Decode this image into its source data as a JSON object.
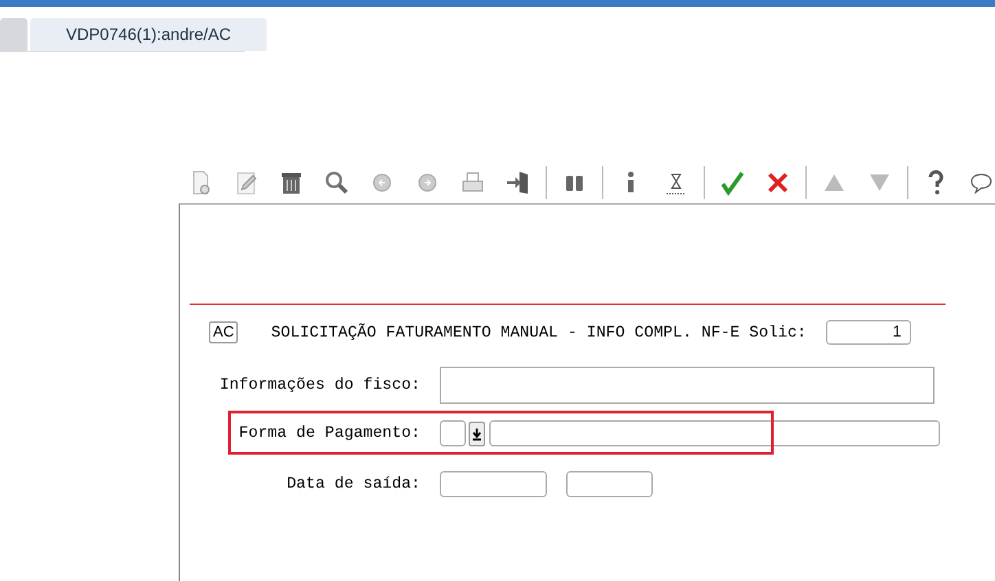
{
  "tabs": [
    {
      "selected": false
    },
    {
      "label": "VDP0746(1):andre/AC",
      "selected": true
    }
  ],
  "form": {
    "mode_badge": "AC",
    "title": "SOLICITAÇÃO FATURAMENTO MANUAL - INFO COMPL. NF-E Solic:",
    "solic_value": "1",
    "fields": [
      {
        "kind": "wide",
        "label": "Informações do fisco:",
        "highlighted": false
      },
      {
        "kind": "lookup",
        "label": "Forma de Pagamento:",
        "highlighted": true
      },
      {
        "kind": "pair",
        "label": "Data de saída:",
        "highlighted": false
      }
    ]
  }
}
